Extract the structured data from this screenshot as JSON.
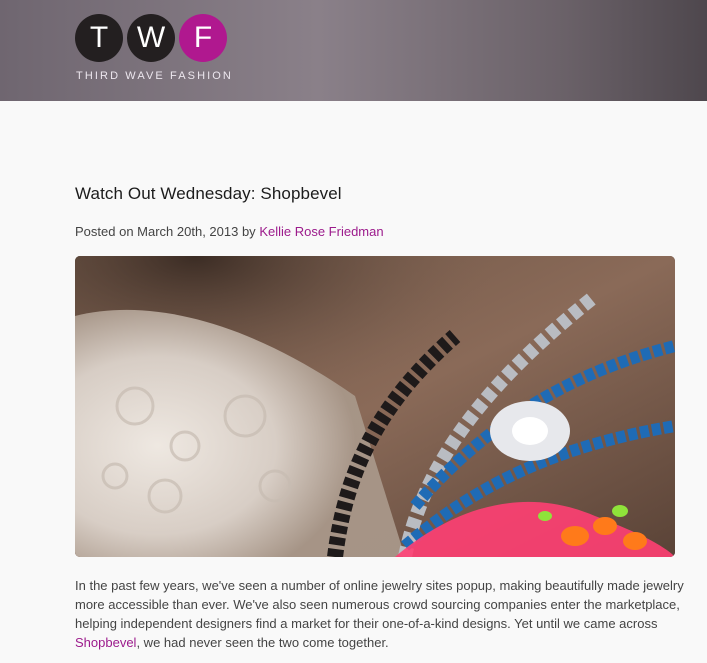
{
  "header": {
    "logo": {
      "letters": [
        "T",
        "W",
        "F"
      ],
      "tagline": "THIRD WAVE FASHION",
      "colors": {
        "dark": "#231f20",
        "accent": "#b0188f"
      }
    }
  },
  "post": {
    "title": "Watch Out Wednesday: Shopbevel",
    "meta_prefix": "Posted on March 20th, 2013 by",
    "author": "Kellie Rose Friedman",
    "hero_image_icon": "jewelry-necklace-photo",
    "body_text_1": "In the past few years, we've seen a number of online jewelry sites popup, making beautifully made jewelry more accessible than ever. We've also seen numerous crowd sourcing companies enter the marketplace, helping independent designers find a market for their one-of-a-kind designs. Yet until we came across",
    "body_link": "Shopbevel",
    "body_text_2": ", we had never seen the two come together."
  },
  "colors": {
    "link": "#9c1b8c",
    "header_bg": "#7a7079"
  }
}
